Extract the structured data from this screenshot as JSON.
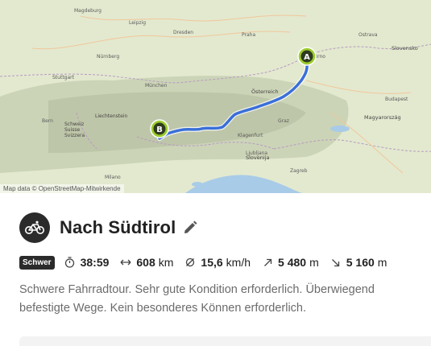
{
  "map": {
    "attribution": "Map data © OpenStreetMap-Mitwirkende",
    "start_marker": "A",
    "end_marker": "B",
    "labels": [
      {
        "text": "Magdeburg",
        "cls": "city"
      },
      {
        "text": "Leipzig",
        "cls": "city"
      },
      {
        "text": "Dresden",
        "cls": "city"
      },
      {
        "text": "Praha",
        "cls": "city"
      },
      {
        "text": "Nürnberg",
        "cls": "city"
      },
      {
        "text": "Stuttgart",
        "cls": "city"
      },
      {
        "text": "München",
        "cls": "city"
      },
      {
        "text": "Brno",
        "cls": "city"
      },
      {
        "text": "Ostrava",
        "cls": "city"
      },
      {
        "text": "Slovensko",
        "cls": "country"
      },
      {
        "text": "Magyarország",
        "cls": "country"
      },
      {
        "text": "Österreich",
        "cls": "country"
      },
      {
        "text": "Liechtenstein",
        "cls": "country"
      },
      {
        "text": "Schweiz",
        "cls": "country"
      },
      {
        "text": "Suisse",
        "cls": "country"
      },
      {
        "text": "Svizzera",
        "cls": "country"
      },
      {
        "text": "Slovenija",
        "cls": "country"
      },
      {
        "text": "Bern",
        "cls": "city"
      },
      {
        "text": "Budapest",
        "cls": "city"
      },
      {
        "text": "Zagreb",
        "cls": "city"
      },
      {
        "text": "Graz",
        "cls": "city"
      },
      {
        "text": "Klagenfurt",
        "cls": "city"
      },
      {
        "text": "Ljubljana",
        "cls": "city"
      },
      {
        "text": "Milano",
        "cls": "city"
      }
    ]
  },
  "tour": {
    "title": "Nach Südtirol",
    "difficulty": "Schwer",
    "duration": "38:59",
    "distance": "608",
    "distance_unit": "km",
    "speed": "15,6",
    "speed_unit": "km/h",
    "uphill": "5 480",
    "uphill_unit": "m",
    "downhill": "5 160",
    "downhill_unit": "m",
    "description": "Schwere Fahrradtour. Sehr gute Kondition erforderlich. Überwiegend befestigte Wege. Kein besonderes Können erforderlich."
  },
  "icons": {
    "activity": "bicycle-icon",
    "edit": "pencil-icon",
    "duration": "stopwatch-icon",
    "distance": "horizontal-arrows-icon",
    "speed": "speed-icon",
    "uphill": "arrow-up-right-icon",
    "downhill": "arrow-down-right-icon"
  },
  "colors": {
    "route": "#3a6fd8",
    "marker": "#9ccc2c",
    "badge": "#2b2b2b"
  }
}
